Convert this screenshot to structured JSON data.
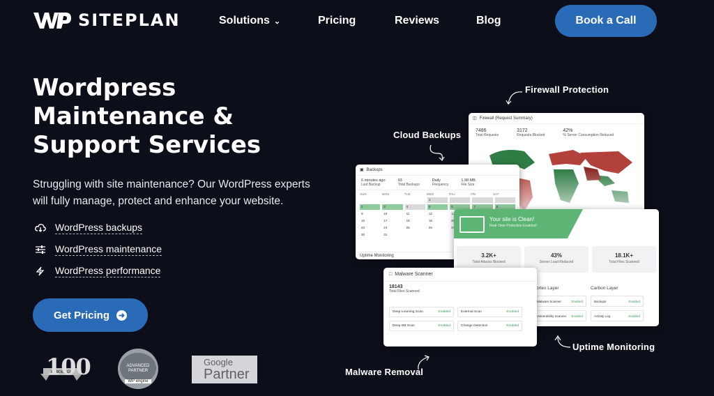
{
  "brand": {
    "name": "SITEPLAN",
    "mark": "WP"
  },
  "nav": {
    "items": [
      {
        "label": "Solutions",
        "dropdown": true
      },
      {
        "label": "Pricing"
      },
      {
        "label": "Reviews"
      },
      {
        "label": "Blog"
      }
    ],
    "cta": "Book a Call"
  },
  "hero": {
    "title_lines": [
      "Wordpress",
      "Maintenance &",
      "Support Services"
    ],
    "subtitle": "Struggling with site maintenance? Our WordPress experts will fully manage, protect and enhance your website.",
    "features": [
      {
        "icon": "cloud-download-icon",
        "label": "WordPress backups"
      },
      {
        "icon": "sliders-icon",
        "label": "WordPress maintenance"
      },
      {
        "icon": "lightning-icon",
        "label": "WordPress performance"
      }
    ],
    "cta": "Get Pricing"
  },
  "badges": {
    "top100": "100",
    "agency": {
      "line1": "ADVANCED",
      "line2": "PARTNER",
      "line3": "WP engine"
    },
    "google": {
      "line1": "Google",
      "line2": "Partner"
    }
  },
  "callouts": {
    "firewall": "Firewall Protection",
    "backups": "Cloud Backups",
    "uptime": "Uptime Monitoring",
    "malware": "Malware Removal"
  },
  "firewall_card": {
    "title": "Firewall (Request Summary)",
    "stats": [
      {
        "v": "7486",
        "l": "Total Requests"
      },
      {
        "v": "3172",
        "l": "Requests Blocked"
      },
      {
        "v": "42%",
        "l": "% Server Consumption Reduced"
      }
    ]
  },
  "backups_card": {
    "title": "Backups",
    "stats": [
      {
        "v": "6 minutes ago",
        "l": "Last Backup"
      },
      {
        "v": "93",
        "l": "Total Backups"
      },
      {
        "v": "Daily",
        "l": "Frequency"
      },
      {
        "v": "1.98 MB",
        "l": "File Size"
      }
    ],
    "days": [
      "SUN",
      "MON",
      "TUE",
      "WED",
      "THU",
      "FRI",
      "SAT"
    ],
    "footer": "Uptime Monitoring",
    "rows": [
      [
        "",
        "",
        "",
        "1",
        "",
        "",
        ""
      ],
      [
        "2",
        "3",
        "4",
        "5",
        "6",
        "7",
        "8"
      ],
      [
        "9",
        "10",
        "11",
        "12",
        "13",
        "14",
        "15"
      ],
      [
        "16",
        "17",
        "18",
        "19",
        "20",
        "21",
        "22"
      ],
      [
        "23",
        "24",
        "25",
        "26",
        "27",
        "28",
        "29"
      ],
      [
        "30",
        "31",
        "",
        "",
        "",
        "",
        ""
      ]
    ]
  },
  "clean_card": {
    "title": "Your site is Clean!",
    "sub": "Real-Time Protection Enabled!",
    "stats": [
      {
        "v": "3.2K+",
        "l": "Total Attacks Blocked"
      },
      {
        "v": "43%",
        "l": "Server Load Reduced"
      },
      {
        "v": "18.1K+",
        "l": "Total Files Scanned"
      }
    ],
    "layers": [
      {
        "name": "Vortex Layer",
        "items": [
          "Malware Scanner",
          "Vulnerability Scanner"
        ]
      },
      {
        "name": "Carbon Layer",
        "items": [
          "Backups",
          "Activity Log"
        ]
      }
    ],
    "status": "Enabled"
  },
  "malware_card": {
    "title": "Malware Scanner",
    "count": "18143",
    "count_label": "Total Files Scanned",
    "items": [
      "Deep Learning Scan",
      "External Scan",
      "Deep DB Scan",
      "Change Detection"
    ],
    "status": "Enabled"
  }
}
